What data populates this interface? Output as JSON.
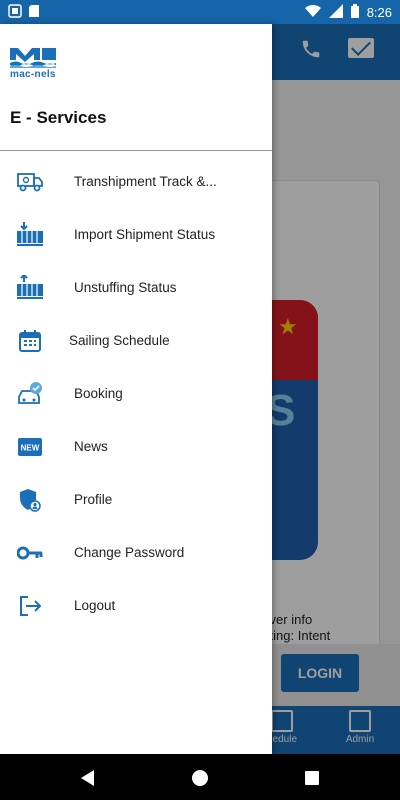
{
  "status_bar": {
    "time": "8:26"
  },
  "background_app": {
    "server_text_line1": "erver info",
    "server_text_line2": "arting: Intent",
    "login_label": "LOGIN",
    "nav_tabs": [
      {
        "label": "hedule"
      },
      {
        "label": "Admin"
      }
    ]
  },
  "drawer": {
    "brand_text": "mac-nels",
    "title": "E - Services",
    "items": [
      {
        "label": "Transhipment Track &...",
        "icon": "truck-icon"
      },
      {
        "label": "Import Shipment Status",
        "icon": "import-container-icon"
      },
      {
        "label": "Unstuffing Status",
        "icon": "unstuffing-container-icon"
      },
      {
        "label": "Sailing Schedule",
        "icon": "calendar-icon"
      },
      {
        "label": "Booking",
        "icon": "car-check-icon"
      },
      {
        "label": "News",
        "icon": "new-badge-icon"
      },
      {
        "label": "Profile",
        "icon": "shield-user-icon"
      },
      {
        "label": "Change Password",
        "icon": "key-icon"
      },
      {
        "label": "Logout",
        "icon": "logout-icon"
      }
    ]
  },
  "colors": {
    "primary": "#1a6fb8",
    "accent_red": "#d32027"
  }
}
